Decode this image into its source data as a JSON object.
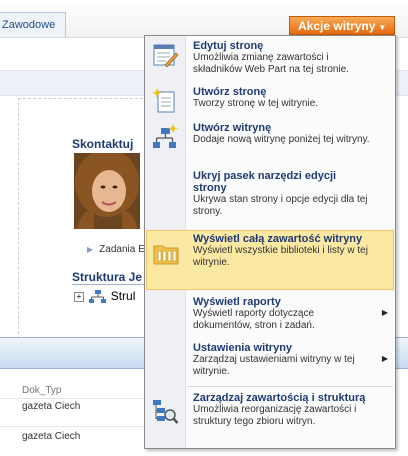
{
  "tabbar": {
    "tab_label": "Zawodowe",
    "actions_label": "Akcje witryny"
  },
  "page": {
    "contact_heading": "Skontaktuj",
    "tasks_link": "Zadania E",
    "structure_heading": "Struktura Je",
    "tree_node": "Strul",
    "column_header": "Dok_Typ",
    "rows": [
      "gazeta Ciech",
      "gazeta Ciech"
    ]
  },
  "menu": {
    "items": [
      {
        "title": "Edytuj stronę",
        "desc": "Umożliwia zmianę zawartości i składników Web Part na tej stronie.",
        "icon": "edit-page-icon",
        "submenu": false
      },
      {
        "title": "Utwórz stronę",
        "desc": "Tworzy stronę w tej witrynie.",
        "icon": "create-page-icon",
        "submenu": false
      },
      {
        "title": "Utwórz witrynę",
        "desc": "Dodaje nową witrynę poniżej tej witryny.",
        "icon": "create-site-icon",
        "submenu": false
      },
      {
        "title": "Ukryj pasek narzędzi edycji strony",
        "desc": "Ukrywa stan strony i opcje edycji dla tej strony.",
        "icon": "",
        "submenu": false
      },
      {
        "title": "Wyświetl całą zawartość witryny",
        "desc": "Wyświetl wszystkie biblioteki i listy w tej witrynie.",
        "icon": "view-all-content-icon",
        "submenu": false,
        "highlight": true
      },
      {
        "title": "Wyświetl raporty",
        "desc": "Wyświetl raporty dotyczące dokumentów, stron i zadań.",
        "icon": "",
        "submenu": true
      },
      {
        "title": "Ustawienia witryny",
        "desc": "Zarządzaj ustawieniami witryny w tej witrynie.",
        "icon": "",
        "submenu": true
      },
      {
        "title": "Zarządzaj zawartością i strukturą",
        "desc": "Umożliwia reorganizację zawartości i struktury tego zbioru witryn.",
        "icon": "manage-content-icon",
        "submenu": false
      }
    ]
  }
}
